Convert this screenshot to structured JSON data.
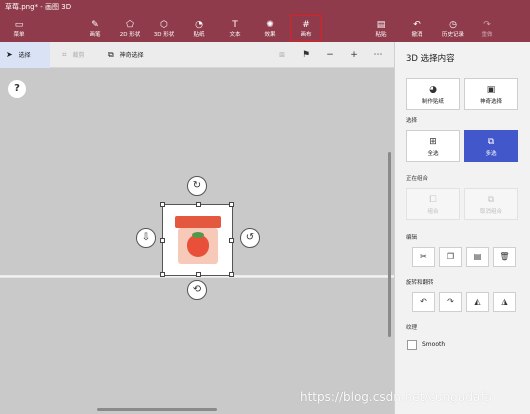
{
  "window": {
    "title": "草莓.png* - 画图 3D"
  },
  "ribbon": {
    "menu": "菜单",
    "tools": [
      "画笔",
      "2D 形状",
      "3D 形状",
      "贴纸",
      "文本",
      "效果",
      "画布"
    ],
    "actions": [
      "粘贴",
      "撤消",
      "历史记录",
      "重做"
    ]
  },
  "toolbar": {
    "select": "选择",
    "crop": "裁剪",
    "magic_select": "神奇选择"
  },
  "canvas": {
    "help": "?"
  },
  "panel": {
    "title": "3D 选择内容",
    "make_sticker": "制作贴纸",
    "magic_select": "神奇选择",
    "select_label": "选择",
    "select_all": "全选",
    "multi_select": "多选",
    "group_label": "正在组合",
    "group": "组合",
    "ungroup": "取消组合",
    "edit_label": "编辑",
    "rotate_label": "旋转和翻转",
    "texture_label": "纹理",
    "smooth": "Smooth"
  },
  "watermark": "https://blog.csdn.net/cungudafa"
}
